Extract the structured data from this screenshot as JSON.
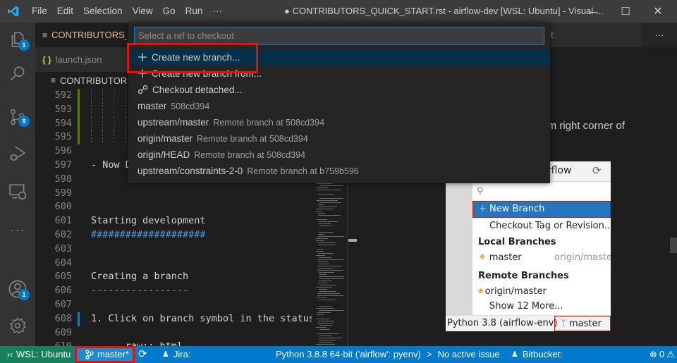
{
  "titlebar": {
    "menu": [
      "File",
      "Edit",
      "Selection",
      "View",
      "Go",
      "Run",
      "···"
    ],
    "title": "● CONTRIBUTORS_QUICK_START.rst - airflow-dev [WSL: Ubuntu] - Visual ...",
    "minimize": "—",
    "maximize": "☐",
    "close": "✕"
  },
  "activitybar": {
    "explorer_badge": "1",
    "scm_badge": "9",
    "accounts_badge": "1",
    "more": "···"
  },
  "tabs": {
    "active_tab": "CONTRIBUTORS_Q",
    "other_tab": "launch.json",
    "preview_tab_fragment": "t",
    "more": "···"
  },
  "breadcrumb": "CONTRIBUTORS_QUICK_START.rst",
  "editor": {
    "lines": [
      {
        "n": "592",
        "text": "",
        "mark": "modified"
      },
      {
        "n": "593",
        "text": "",
        "mark": "modified"
      },
      {
        "n": "594",
        "text": "",
        "mark": "modified"
      },
      {
        "n": "595",
        "text": "",
        "mark": "modified"
      },
      {
        "n": "596",
        "text": "",
        "mark": ""
      },
      {
        "n": "597",
        "text": "- Now D",
        "mark": ""
      },
      {
        "n": "598",
        "text": "",
        "mark": ""
      },
      {
        "n": "599",
        "text": "",
        "mark": ""
      },
      {
        "n": "600",
        "text": "",
        "mark": ""
      },
      {
        "n": "601",
        "text": "Starting development",
        "mark": ""
      },
      {
        "n": "602",
        "text": "####################",
        "mark": "",
        "style": "heading"
      },
      {
        "n": "603",
        "text": "",
        "mark": ""
      },
      {
        "n": "604",
        "text": "",
        "mark": ""
      },
      {
        "n": "605",
        "text": "Creating a branch",
        "mark": ""
      },
      {
        "n": "606",
        "text": "-----------------",
        "mark": "",
        "style": "heading"
      },
      {
        "n": "607",
        "text": "",
        "mark": ""
      },
      {
        "n": "608",
        "text": "1. Click on branch symbol in the status",
        "mark": "added"
      },
      {
        "n": "609",
        "text": "",
        "mark": ""
      },
      {
        "n": "610",
        "text": "   .. raw:: html",
        "mark": ""
      }
    ]
  },
  "preview": {
    "text_fragment": "ttom right corner of"
  },
  "embedded_image": {
    "header_fragment": "irflow",
    "new_branch": "New Branch",
    "checkout_tag": "Checkout Tag or Revision...",
    "local_header": "Local Branches",
    "local_branch": "master",
    "local_tracking": "origin/maste",
    "remote_header": "Remote Branches",
    "remote_branch": "origin/master",
    "show_more": "Show 12 More...",
    "status_python": "Python 3.8 (airflow-env)",
    "status_branch": "master"
  },
  "quickpick": {
    "placeholder": "Select a ref to checkout",
    "actions": [
      {
        "icon": "plus",
        "label": "Create new branch..."
      },
      {
        "icon": "plus",
        "label": "Create new branch from..."
      },
      {
        "icon": "debug-disconnect",
        "label": "Checkout detached..."
      }
    ],
    "refs": [
      {
        "name": "master",
        "desc": "508cd394"
      },
      {
        "name": "upstream/master",
        "desc": "Remote branch at 508cd394"
      },
      {
        "name": "origin/master",
        "desc": "Remote branch at 508cd394"
      },
      {
        "name": "origin/HEAD",
        "desc": "Remote branch at 508cd394"
      },
      {
        "name": "upstream/constraints-2-0",
        "desc": "Remote branch at b759b596"
      }
    ]
  },
  "statusbar": {
    "remote": "WSL: Ubuntu",
    "branch": "master*",
    "jira": "Jira:",
    "python": "Python 3.8.8 64-bit ('airflow': pyenv)",
    "issue": "No active issue",
    "bitbucket": "Bitbucket:",
    "errors": "0"
  },
  "colors": {
    "accent": "#007acc",
    "remote_indicator": "#16825d",
    "highlight_box": "#e51400",
    "selection": "#062f4a"
  }
}
